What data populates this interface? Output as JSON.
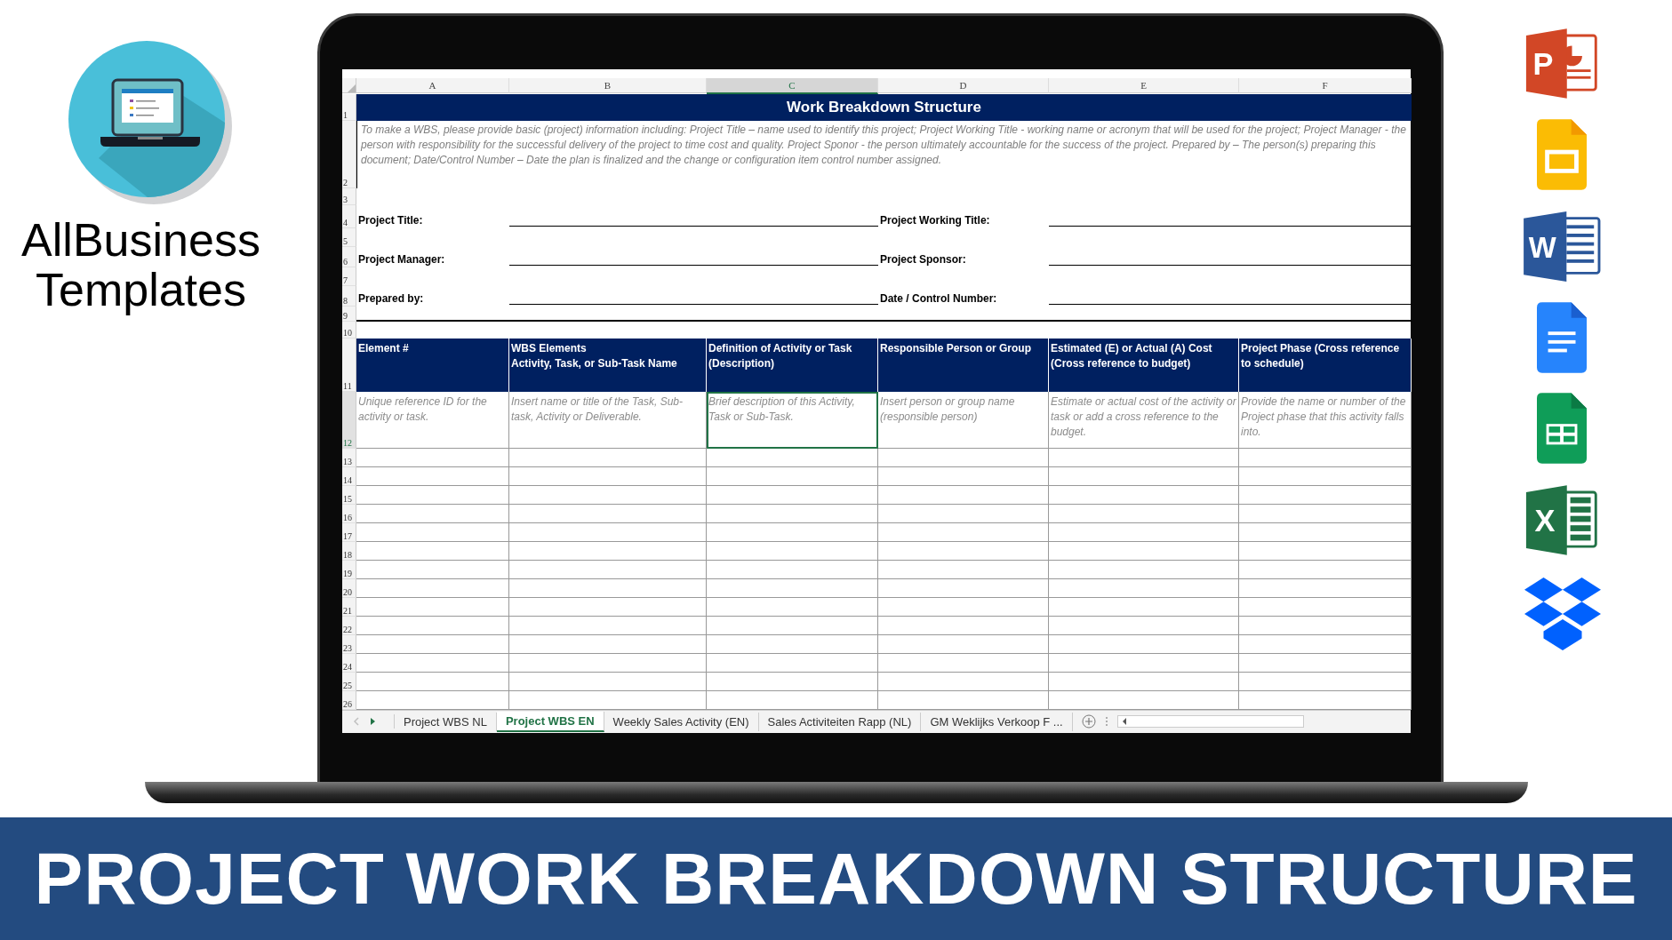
{
  "branding": {
    "lines": [
      "AllBusiness",
      "Templates"
    ]
  },
  "app_icons": [
    {
      "kind": "powerpoint",
      "letter": "P"
    },
    {
      "kind": "slides"
    },
    {
      "kind": "word",
      "letter": "W"
    },
    {
      "kind": "docs"
    },
    {
      "kind": "sheets"
    },
    {
      "kind": "excel",
      "letter": "X"
    },
    {
      "kind": "dropbox"
    }
  ],
  "spreadsheet": {
    "column_headers": [
      {
        "label": "A",
        "selected": false
      },
      {
        "label": "B",
        "selected": false
      },
      {
        "label": "C",
        "selected": true
      },
      {
        "label": "D",
        "selected": false
      },
      {
        "label": "E",
        "selected": false
      },
      {
        "label": "F",
        "selected": false
      }
    ],
    "row_numbers": [
      "1",
      "2",
      "3",
      "4",
      "5",
      "6",
      "7",
      "8",
      "9",
      "10",
      "11",
      "12",
      "13",
      "14",
      "15",
      "16",
      "17",
      "18",
      "19",
      "20",
      "21",
      "22",
      "23",
      "24",
      "25",
      "26"
    ],
    "title": "Work Breakdown Structure",
    "instructions": "To make a WBS, please provide basic (project) information including: Project Title – name used to identify this project; Project Working Title - working name or acronym that will be used for the project; Project Manager - the person with responsibility for the successful delivery of the project to time cost and quality. Project Sponor - the person ultimately accountable for the success of the project. Prepared by – The person(s) preparing this document; Date/Control Number – Date the plan is finalized and the change or configuration item control number assigned.",
    "fields": [
      {
        "label": "Project Title:"
      },
      {
        "label": "Project Working Title:"
      },
      {
        "label": "Project Manager:"
      },
      {
        "label": "Project Sponsor:"
      },
      {
        "label": "Prepared by:"
      },
      {
        "label": "Date / Control Number:"
      }
    ],
    "table_headers": [
      "Element #",
      "WBS Elements\nActivity, Task, or Sub-Task Name",
      "Definition of Activity or Task (Description)",
      "Responsible Person or Group",
      "Estimated (E) or Actual (A) Cost (Cross reference to budget)",
      "Project Phase (Cross reference to schedule)"
    ],
    "example_row": [
      {
        "text": "Unique reference ID for the activity or task.",
        "selected": false
      },
      {
        "text": "Insert name or title of the Task, Sub-task, Activity or Deliverable.",
        "selected": false
      },
      {
        "text": "Brief description of this Activity, Task or Sub-Task.",
        "selected": true
      },
      {
        "text": "Insert person or group name (responsible person)",
        "selected": false
      },
      {
        "text": "Estimate or actual cost of the activity or task or add a cross reference to the budget.",
        "selected": false
      },
      {
        "text": "Provide the name or number of the Project phase that this activity falls into.",
        "selected": false
      }
    ],
    "sheet_tabs": [
      {
        "label": "Project WBS NL",
        "selected": false
      },
      {
        "label": "Project WBS EN",
        "selected": true
      },
      {
        "label": "Weekly Sales Activity (EN)",
        "selected": false
      },
      {
        "label": "Sales Activiteiten Rapp (NL)",
        "selected": false
      },
      {
        "label": "GM Weklijks Verkoop F ...",
        "selected": false
      }
    ]
  },
  "banner": "PROJECT WORK BREAKDOWN STRUCTURE"
}
